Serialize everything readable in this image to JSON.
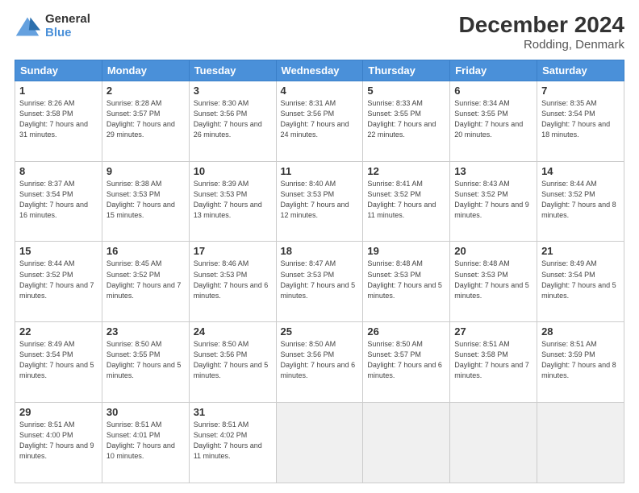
{
  "header": {
    "logo_line1": "General",
    "logo_line2": "Blue",
    "title": "December 2024",
    "subtitle": "Rodding, Denmark"
  },
  "days_of_week": [
    "Sunday",
    "Monday",
    "Tuesday",
    "Wednesday",
    "Thursday",
    "Friday",
    "Saturday"
  ],
  "weeks": [
    [
      {
        "day": "1",
        "sunrise": "8:26 AM",
        "sunset": "3:58 PM",
        "daylight": "7 hours and 31 minutes."
      },
      {
        "day": "2",
        "sunrise": "8:28 AM",
        "sunset": "3:57 PM",
        "daylight": "7 hours and 29 minutes."
      },
      {
        "day": "3",
        "sunrise": "8:30 AM",
        "sunset": "3:56 PM",
        "daylight": "7 hours and 26 minutes."
      },
      {
        "day": "4",
        "sunrise": "8:31 AM",
        "sunset": "3:56 PM",
        "daylight": "7 hours and 24 minutes."
      },
      {
        "day": "5",
        "sunrise": "8:33 AM",
        "sunset": "3:55 PM",
        "daylight": "7 hours and 22 minutes."
      },
      {
        "day": "6",
        "sunrise": "8:34 AM",
        "sunset": "3:55 PM",
        "daylight": "7 hours and 20 minutes."
      },
      {
        "day": "7",
        "sunrise": "8:35 AM",
        "sunset": "3:54 PM",
        "daylight": "7 hours and 18 minutes."
      }
    ],
    [
      {
        "day": "8",
        "sunrise": "8:37 AM",
        "sunset": "3:54 PM",
        "daylight": "7 hours and 16 minutes."
      },
      {
        "day": "9",
        "sunrise": "8:38 AM",
        "sunset": "3:53 PM",
        "daylight": "7 hours and 15 minutes."
      },
      {
        "day": "10",
        "sunrise": "8:39 AM",
        "sunset": "3:53 PM",
        "daylight": "7 hours and 13 minutes."
      },
      {
        "day": "11",
        "sunrise": "8:40 AM",
        "sunset": "3:53 PM",
        "daylight": "7 hours and 12 minutes."
      },
      {
        "day": "12",
        "sunrise": "8:41 AM",
        "sunset": "3:52 PM",
        "daylight": "7 hours and 11 minutes."
      },
      {
        "day": "13",
        "sunrise": "8:43 AM",
        "sunset": "3:52 PM",
        "daylight": "7 hours and 9 minutes."
      },
      {
        "day": "14",
        "sunrise": "8:44 AM",
        "sunset": "3:52 PM",
        "daylight": "7 hours and 8 minutes."
      }
    ],
    [
      {
        "day": "15",
        "sunrise": "8:44 AM",
        "sunset": "3:52 PM",
        "daylight": "7 hours and 7 minutes."
      },
      {
        "day": "16",
        "sunrise": "8:45 AM",
        "sunset": "3:52 PM",
        "daylight": "7 hours and 7 minutes."
      },
      {
        "day": "17",
        "sunrise": "8:46 AM",
        "sunset": "3:53 PM",
        "daylight": "7 hours and 6 minutes."
      },
      {
        "day": "18",
        "sunrise": "8:47 AM",
        "sunset": "3:53 PM",
        "daylight": "7 hours and 5 minutes."
      },
      {
        "day": "19",
        "sunrise": "8:48 AM",
        "sunset": "3:53 PM",
        "daylight": "7 hours and 5 minutes."
      },
      {
        "day": "20",
        "sunrise": "8:48 AM",
        "sunset": "3:53 PM",
        "daylight": "7 hours and 5 minutes."
      },
      {
        "day": "21",
        "sunrise": "8:49 AM",
        "sunset": "3:54 PM",
        "daylight": "7 hours and 5 minutes."
      }
    ],
    [
      {
        "day": "22",
        "sunrise": "8:49 AM",
        "sunset": "3:54 PM",
        "daylight": "7 hours and 5 minutes."
      },
      {
        "day": "23",
        "sunrise": "8:50 AM",
        "sunset": "3:55 PM",
        "daylight": "7 hours and 5 minutes."
      },
      {
        "day": "24",
        "sunrise": "8:50 AM",
        "sunset": "3:56 PM",
        "daylight": "7 hours and 5 minutes."
      },
      {
        "day": "25",
        "sunrise": "8:50 AM",
        "sunset": "3:56 PM",
        "daylight": "7 hours and 6 minutes."
      },
      {
        "day": "26",
        "sunrise": "8:50 AM",
        "sunset": "3:57 PM",
        "daylight": "7 hours and 6 minutes."
      },
      {
        "day": "27",
        "sunrise": "8:51 AM",
        "sunset": "3:58 PM",
        "daylight": "7 hours and 7 minutes."
      },
      {
        "day": "28",
        "sunrise": "8:51 AM",
        "sunset": "3:59 PM",
        "daylight": "7 hours and 8 minutes."
      }
    ],
    [
      {
        "day": "29",
        "sunrise": "8:51 AM",
        "sunset": "4:00 PM",
        "daylight": "7 hours and 9 minutes."
      },
      {
        "day": "30",
        "sunrise": "8:51 AM",
        "sunset": "4:01 PM",
        "daylight": "7 hours and 10 minutes."
      },
      {
        "day": "31",
        "sunrise": "8:51 AM",
        "sunset": "4:02 PM",
        "daylight": "7 hours and 11 minutes."
      },
      null,
      null,
      null,
      null
    ]
  ]
}
